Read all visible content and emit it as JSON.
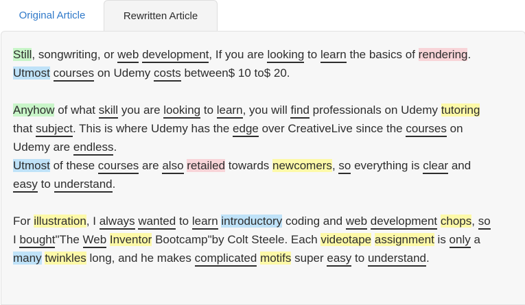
{
  "tabs": [
    {
      "label": "Original Article",
      "active": true
    },
    {
      "label": "Rewritten Article",
      "active": false
    }
  ],
  "colors": {
    "active_tab_text": "#2f79c9",
    "highlight_green": "#c8f5c8",
    "highlight_red": "#f8d4d8",
    "highlight_blue": "#bfe2f8",
    "highlight_yellow": "#fdf9a8"
  },
  "paragraphs": [
    [
      {
        "t": "Still",
        "hl": "green",
        "u": false
      },
      {
        "t": ", songwriting, or "
      },
      {
        "t": "web",
        "u": true
      },
      {
        "t": " "
      },
      {
        "t": "development",
        "u": true
      },
      {
        "t": ", If you are "
      },
      {
        "t": "looking",
        "u": true
      },
      {
        "t": " to "
      },
      {
        "t": "learn",
        "u": true
      },
      {
        "t": " the basics of "
      },
      {
        "t": "rendering",
        "hl": "red"
      },
      {
        "t": ". "
      },
      {
        "t": "Utmost",
        "hl": "blue"
      },
      {
        "t": " "
      },
      {
        "t": "courses",
        "u": true
      },
      {
        "t": " on Udemy "
      },
      {
        "t": "costs",
        "u": true
      },
      {
        "t": " between$ 10 to$ 20."
      }
    ],
    [
      {
        "t": "Anyhow",
        "hl": "green"
      },
      {
        "t": " of what "
      },
      {
        "t": "skill",
        "u": true
      },
      {
        "t": " you are "
      },
      {
        "t": "looking",
        "u": true
      },
      {
        "t": " to "
      },
      {
        "t": "learn",
        "u": true
      },
      {
        "t": ", you will "
      },
      {
        "t": "find",
        "u": true
      },
      {
        "t": " professionals on Udemy "
      },
      {
        "t": "tutoring",
        "hl": "yellow"
      },
      {
        "t": " that "
      },
      {
        "t": "subject",
        "u": true
      },
      {
        "t": ". This is where Udemy has the "
      },
      {
        "t": "edge",
        "u": true
      },
      {
        "t": " over CreativeLive since the "
      },
      {
        "t": "courses",
        "u": true
      },
      {
        "t": " on Udemy are "
      },
      {
        "t": "endless",
        "u": true
      },
      {
        "t": ".",
        "br": true
      },
      {
        "t": "Utmost",
        "hl": "blue"
      },
      {
        "t": " of these "
      },
      {
        "t": "courses",
        "u": true
      },
      {
        "t": " are "
      },
      {
        "t": "also",
        "u": true
      },
      {
        "t": " "
      },
      {
        "t": "retailed",
        "hl": "red"
      },
      {
        "t": " towards "
      },
      {
        "t": "newcomers",
        "hl": "yellow"
      },
      {
        "t": ", "
      },
      {
        "t": "so",
        "u": true
      },
      {
        "t": " everything is "
      },
      {
        "t": "clear",
        "u": true
      },
      {
        "t": " and "
      },
      {
        "t": "easy",
        "u": true
      },
      {
        "t": " to "
      },
      {
        "t": "understand",
        "u": true
      },
      {
        "t": "."
      }
    ],
    [
      {
        "t": "For "
      },
      {
        "t": "illustration",
        "hl": "yellow"
      },
      {
        "t": ", I "
      },
      {
        "t": "always",
        "u": true
      },
      {
        "t": " "
      },
      {
        "t": "wanted",
        "u": true
      },
      {
        "t": " to "
      },
      {
        "t": "learn",
        "u": true
      },
      {
        "t": " "
      },
      {
        "t": "introductory",
        "hl": "blue"
      },
      {
        "t": " coding and "
      },
      {
        "t": "web",
        "u": true
      },
      {
        "t": " "
      },
      {
        "t": "development",
        "u": true
      },
      {
        "t": " "
      },
      {
        "t": "chops",
        "hl": "yellow"
      },
      {
        "t": ", "
      },
      {
        "t": "so",
        "u": true
      },
      {
        "t": " I "
      },
      {
        "t": "bought",
        "u": true
      },
      {
        "t": "\"The "
      },
      {
        "t": "Web",
        "u": true
      },
      {
        "t": " "
      },
      {
        "t": "Inventor",
        "hl": "yellow"
      },
      {
        "t": " Bootcamp\"by Colt Steele. Each "
      },
      {
        "t": "videotape",
        "hl": "yellow"
      },
      {
        "t": " "
      },
      {
        "t": "assignment",
        "hl": "yellow"
      },
      {
        "t": " is "
      },
      {
        "t": "only",
        "u": true
      },
      {
        "t": " a "
      },
      {
        "t": "many",
        "hl": "blue"
      },
      {
        "t": " "
      },
      {
        "t": "twinkles",
        "hl": "yellow"
      },
      {
        "t": " long, and he makes "
      },
      {
        "t": "complicated",
        "u": true
      },
      {
        "t": " "
      },
      {
        "t": "motifs",
        "hl": "yellow"
      },
      {
        "t": " super "
      },
      {
        "t": "easy",
        "u": true
      },
      {
        "t": " to "
      },
      {
        "t": "understand",
        "u": true
      },
      {
        "t": "."
      }
    ]
  ]
}
